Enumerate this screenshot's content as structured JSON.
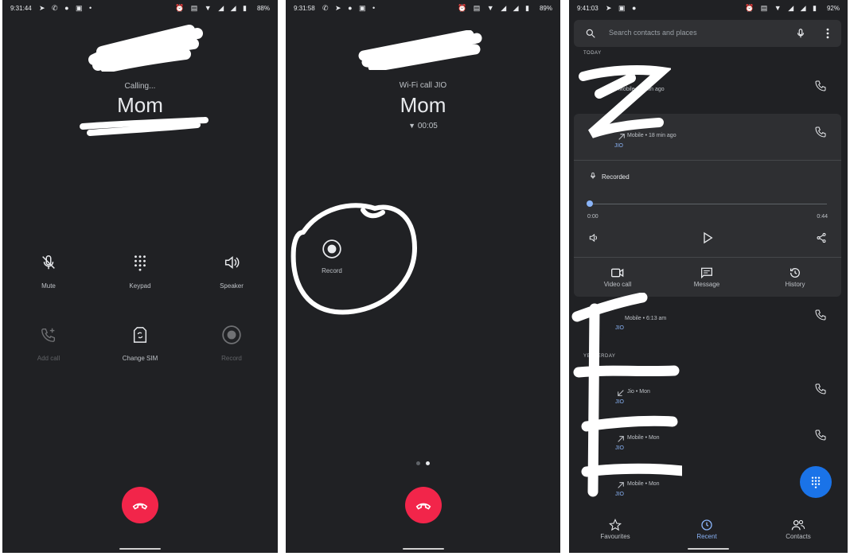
{
  "panel1": {
    "status": {
      "time": "9:31:44",
      "battery": "88%"
    },
    "calling_label": "Calling...",
    "contact_name": "Mom",
    "controls": [
      {
        "label": "Mute",
        "icon": "mic-off-icon",
        "enabled": true
      },
      {
        "label": "Keypad",
        "icon": "dialpad-icon",
        "enabled": true
      },
      {
        "label": "Speaker",
        "icon": "speaker-icon",
        "enabled": true
      },
      {
        "label": "Add call",
        "icon": "add-call-icon",
        "enabled": false
      },
      {
        "label": "Change SIM",
        "icon": "sim-swap-icon",
        "enabled": true
      },
      {
        "label": "Record",
        "icon": "record-icon",
        "enabled": false
      }
    ]
  },
  "panel2": {
    "status": {
      "time": "9:31:58",
      "battery": "89%"
    },
    "call_type": "Wi-Fi call JIO",
    "contact_name": "Mom",
    "duration": "00:05",
    "record_label": "Record"
  },
  "panel3": {
    "status": {
      "time": "9:41:03",
      "battery": "92%"
    },
    "search_placeholder": "Search contacts and places",
    "section_today": "TODAY",
    "section_yesterday": "YESTERDAY",
    "row1_sub": "Mobile • 9 min ago",
    "row2_sub": "Mobile • 18 min ago",
    "row2_sim": "JIO",
    "recorded_label": "Recorded",
    "time_start": "0:00",
    "time_end": "0:44",
    "progress": 0.0,
    "actions": [
      "Video call",
      "Message",
      "History"
    ],
    "row3_sub": "Mobile • 6:13 am",
    "row3_sim": "JIO",
    "row4_sub": "Jio • Mon",
    "row4_sim": "JIO",
    "row5_sub": "Mobile • Mon",
    "row5_sim": "JIO",
    "row6_sub": "Mobile • Mon",
    "row6_sim": "JIO",
    "tabs": [
      "Favourites",
      "Recent",
      "Contacts"
    ],
    "active_tab": "Recent"
  },
  "colors": {
    "background": "#202124",
    "end_call": "#f2254a",
    "accent": "#8ab4f8",
    "fab": "#1a73e8"
  }
}
